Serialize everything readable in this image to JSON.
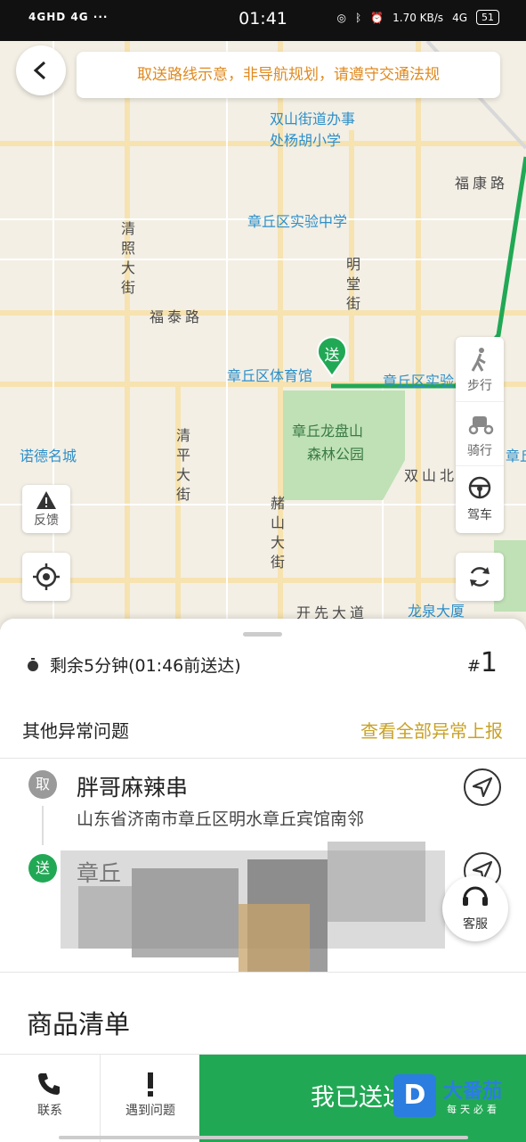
{
  "status_bar": {
    "network": "4GHD 4G ···",
    "time": "01:41",
    "speed": "1.70 KB/s",
    "signal": "4G",
    "battery": "51"
  },
  "header": {
    "notice": "取送路线示意，非导航规划，请遵守交通法规"
  },
  "map": {
    "labels": {
      "school1_a": "双山街道办事",
      "school1_b": "处杨胡小学",
      "road_fukang": "福康路",
      "school2": "章丘区实验中学",
      "road_qingzhao": "清照大街",
      "road_mingtang": "明堂街",
      "road_futai": "福泰路",
      "stadium": "章丘区体育馆",
      "school3": "章丘区实验",
      "park_a": "章丘龙盘山",
      "park_b": "森林公园",
      "road_shuangshan": "双山北",
      "nuode": "诺德名城",
      "road_qingping": "清平大街",
      "road_xieshan": "赭山大街",
      "road_kaixian": "开先大道",
      "longquan": "龙泉大厦",
      "edge_zhang": "章丘"
    },
    "pin": "送",
    "modes": {
      "walk": "步行",
      "ride": "骑行",
      "drive": "驾车"
    },
    "feedback": "反馈"
  },
  "order": {
    "remaining": "剩余5分钟(01:46前送达)",
    "number_hash": "#",
    "number": "1",
    "other_issues": "其他异常问题",
    "view_all": "查看全部异常上报",
    "pickup_badge": "取",
    "shop_name": "胖哥麻辣串",
    "shop_address": "山东省济南市章丘区明水章丘宾馆南邻",
    "drop_badge": "送",
    "drop_name_partial": "章丘",
    "service": "客服",
    "goods_title": "商品清单"
  },
  "bottom_bar": {
    "contact": "联系",
    "problem": "遇到问题",
    "delivered": "我已送达"
  },
  "watermark": {
    "logo": "D",
    "text": "大番茄",
    "sub": "每天必看"
  },
  "colors": {
    "accent_green": "#21a855",
    "notice_orange": "#e08a1e",
    "link_gold": "#c8a227"
  }
}
